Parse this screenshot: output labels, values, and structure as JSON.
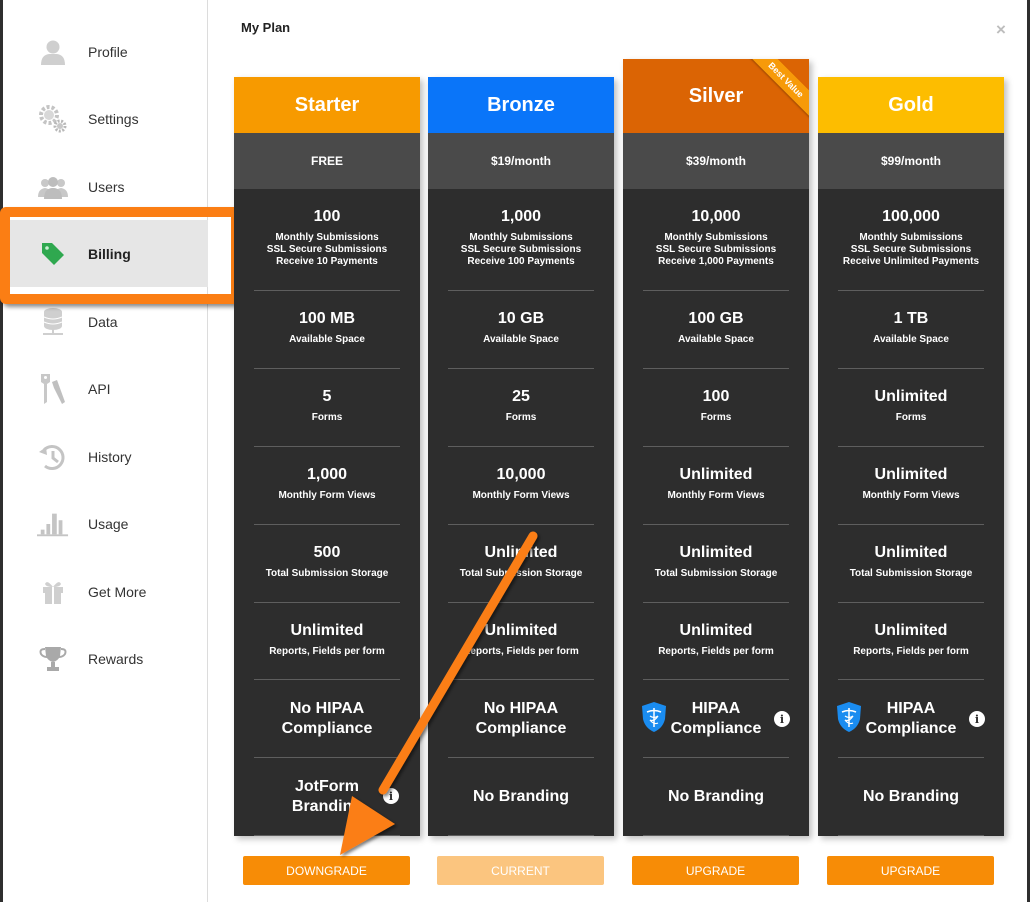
{
  "sidebar": {
    "items": [
      {
        "label": "Profile",
        "icon": "user-icon"
      },
      {
        "label": "Settings",
        "icon": "gear-icon"
      },
      {
        "label": "Users",
        "icon": "users-icon"
      },
      {
        "label": "Billing",
        "icon": "tag-icon",
        "active": true
      },
      {
        "label": "Data",
        "icon": "database-icon"
      },
      {
        "label": "API",
        "icon": "keys-icon"
      },
      {
        "label": "History",
        "icon": "history-icon"
      },
      {
        "label": "Usage",
        "icon": "bar-chart-icon"
      },
      {
        "label": "Get More",
        "icon": "gift-icon"
      },
      {
        "label": "Rewards",
        "icon": "trophy-icon"
      }
    ]
  },
  "main": {
    "title": "My Plan",
    "close_icon": "×"
  },
  "plans": [
    {
      "name": "Starter",
      "color": "#f79a00",
      "price": "FREE",
      "submissions": "100",
      "submissions_lines": [
        "Monthly Submissions",
        "SSL Secure Submissions",
        "Receive 10 Payments"
      ],
      "space": "100 MB",
      "space_label": "Available Space",
      "forms": "5",
      "forms_label": "Forms",
      "views": "1,000",
      "views_label": "Monthly Form Views",
      "storage": "500",
      "storage_label": "Total Submission Storage",
      "reports": "Unlimited",
      "reports_label": "Reports, Fields per form",
      "hipaa_line1": "No HIPAA",
      "hipaa_line2": "Compliance",
      "branding_line1": "JotForm",
      "branding_line2": "Branding",
      "button": "DOWNGRADE"
    },
    {
      "name": "Bronze",
      "color": "#0a75f9",
      "price": "$19/month",
      "submissions": "1,000",
      "submissions_lines": [
        "Monthly Submissions",
        "SSL Secure Submissions",
        "Receive 100 Payments"
      ],
      "space": "10 GB",
      "space_label": "Available Space",
      "forms": "25",
      "forms_label": "Forms",
      "views": "10,000",
      "views_label": "Monthly Form Views",
      "storage": "Unlimited",
      "storage_label": "Total Submission Storage",
      "reports": "Unlimited",
      "reports_label": "Reports, Fields per form",
      "hipaa_line1": "No HIPAA",
      "hipaa_line2": "Compliance",
      "branding_line1": "No Branding",
      "branding_line2": "",
      "button": "CURRENT"
    },
    {
      "name": "Silver",
      "color": "#db6404",
      "price": "$39/month",
      "ribbon": "Best Value",
      "submissions": "10,000",
      "submissions_lines": [
        "Monthly Submissions",
        "SSL Secure Submissions",
        "Receive 1,000 Payments"
      ],
      "space": "100 GB",
      "space_label": "Available Space",
      "forms": "100",
      "forms_label": "Forms",
      "views": "Unlimited",
      "views_label": "Monthly Form Views",
      "storage": "Unlimited",
      "storage_label": "Total Submission Storage",
      "reports": "Unlimited",
      "reports_label": "Reports, Fields per form",
      "hipaa_line1": "HIPAA",
      "hipaa_line2": "Compliance",
      "branding_line1": "No Branding",
      "branding_line2": "",
      "button": "UPGRADE"
    },
    {
      "name": "Gold",
      "color": "#fdbd00",
      "price": "$99/month",
      "submissions": "100,000",
      "submissions_lines": [
        "Monthly Submissions",
        "SSL Secure Submissions",
        "Receive Unlimited Payments"
      ],
      "space": "1 TB",
      "space_label": "Available Space",
      "forms": "Unlimited",
      "forms_label": "Forms",
      "views": "Unlimited",
      "views_label": "Monthly Form Views",
      "storage": "Unlimited",
      "storage_label": "Total Submission Storage",
      "reports": "Unlimited",
      "reports_label": "Reports, Fields per form",
      "hipaa_line1": "HIPAA",
      "hipaa_line2": "Compliance",
      "branding_line1": "No Branding",
      "branding_line2": "",
      "button": "UPGRADE"
    }
  ],
  "info_icon": "i",
  "colors": {
    "accent": "#f78c06",
    "annotation": "#fb7e14",
    "card_bg": "#2d2d2d",
    "price_bg": "#4a4a4a"
  }
}
